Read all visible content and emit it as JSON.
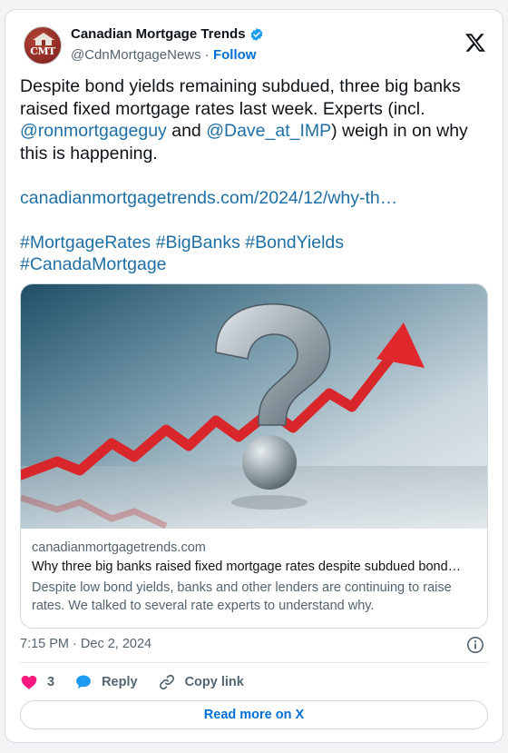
{
  "author": {
    "display_name": "Canadian Mortgage Trends",
    "handle": "@CdnMortgageNews",
    "separator": "·",
    "follow_label": "Follow",
    "avatar_text": "CMT"
  },
  "tweet": {
    "text_line1": "Despite bond yields remaining subdued, three big banks raised fixed mortgage rates last week. Experts (incl. ",
    "mention1": "@ronmortgageguy",
    "text_and": " and ",
    "mention2": "@Dave_at_IMP",
    "text_line2": ") weigh in on why this is happening.",
    "url": "canadianmortgagetrends.com/2024/12/why-th…",
    "hashtags": [
      "#MortgageRates",
      "#BigBanks",
      "#BondYields",
      "#CanadaMortgage"
    ]
  },
  "link_card": {
    "domain": "canadianmortgagetrends.com",
    "title": "Why three big banks raised fixed mortgage rates despite subdued bond…",
    "description": "Despite low bond yields, banks and other lenders are continuing to raise rates. We talked to several rate experts to understand why."
  },
  "meta": {
    "time": "7:15 PM",
    "separator": "·",
    "date": "Dec 2, 2024"
  },
  "actions": {
    "like_count": "3",
    "reply_label": "Reply",
    "copy_label": "Copy link"
  },
  "read_more_label": "Read more on X",
  "colors": {
    "link": "#1d6fa5",
    "follow": "#006fd6",
    "like": "#f91880",
    "verified": "#1d9bf0"
  }
}
